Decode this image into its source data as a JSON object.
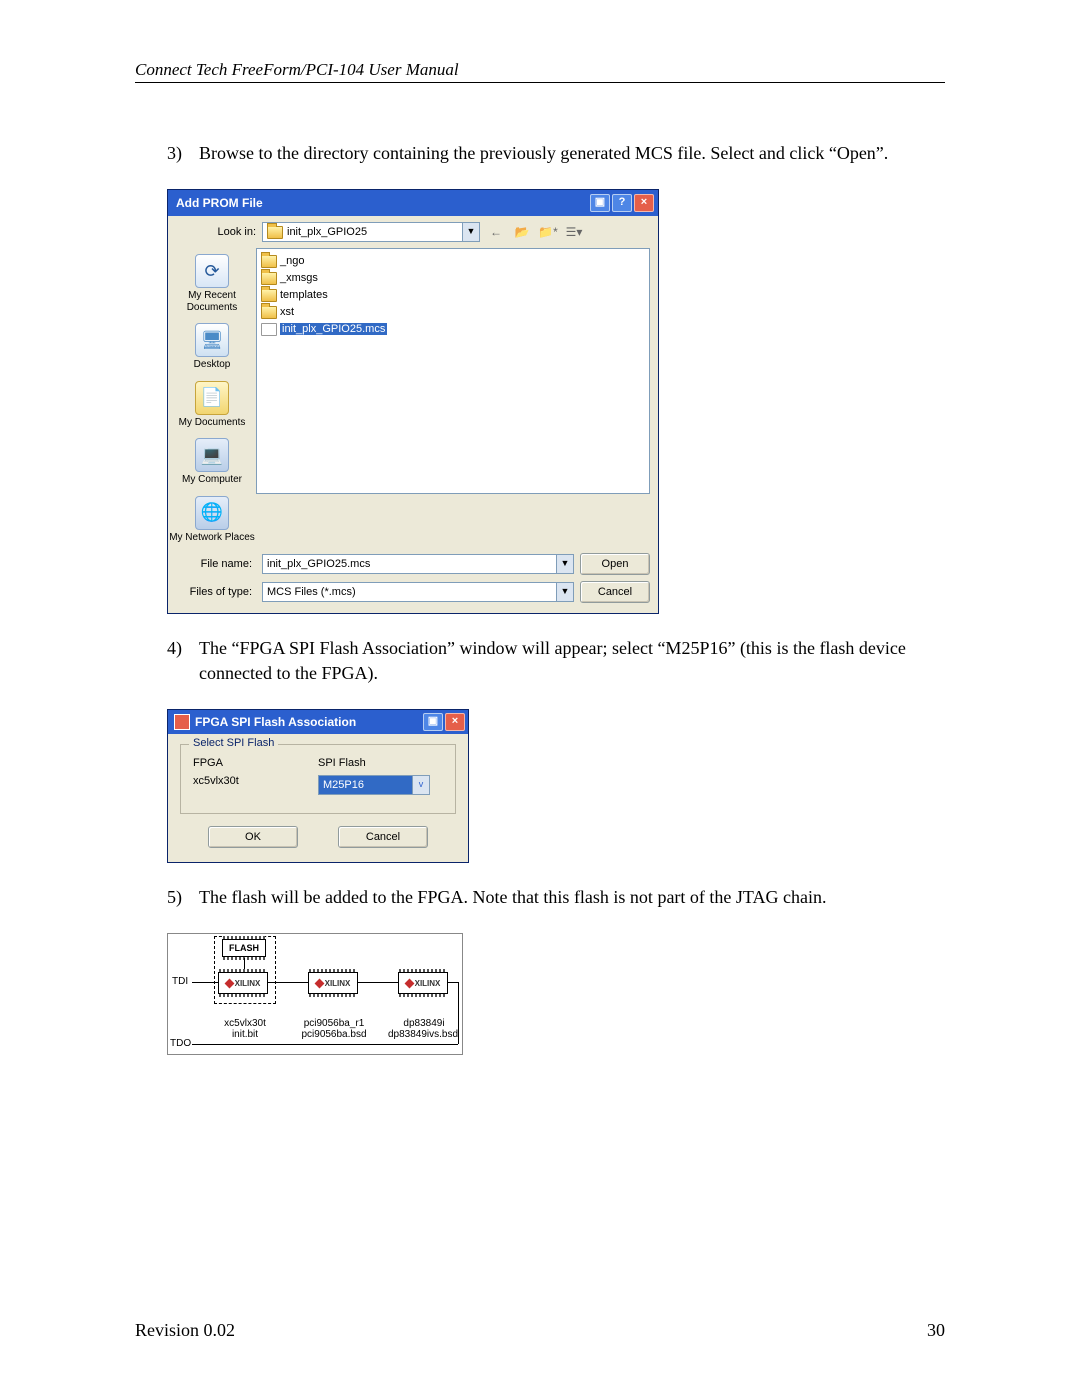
{
  "header": "Connect Tech FreeForm/PCI-104 User Manual",
  "steps": {
    "s3": {
      "num": "3)",
      "text": "Browse to the directory containing the previously generated MCS file.  Select and click “Open”."
    },
    "s4": {
      "num": "4)",
      "text": "The “FPGA SPI Flash Association” window will appear; select “M25P16” (this is the flash device connected to the FPGA)."
    },
    "s5": {
      "num": "5)",
      "text": "The flash will be added to the FPGA.  Note that this flash is not part of the JTAG chain."
    }
  },
  "dlg1": {
    "title": "Add PROM File",
    "lookin_label": "Look in:",
    "lookin_value": "init_plx_GPIO25",
    "places": {
      "recent": "My Recent Documents",
      "desktop": "Desktop",
      "mydocs": "My Documents",
      "mycomp": "My Computer",
      "mynet": "My Network Places"
    },
    "files": {
      "f0": "_ngo",
      "f1": "_xmsgs",
      "f2": "templates",
      "f3": "xst",
      "f4": "init_plx_GPIO25.mcs"
    },
    "filename_label": "File name:",
    "filename_value": "init_plx_GPIO25.mcs",
    "filetype_label": "Files of type:",
    "filetype_value": "MCS Files (*.mcs)",
    "open": "Open",
    "cancel": "Cancel"
  },
  "dlg2": {
    "title": "FPGA SPI Flash Association",
    "legend": "Select SPI Flash",
    "fpga_header": "FPGA",
    "fpga_value": "xc5vlx30t",
    "spi_header": "SPI Flash",
    "spi_value": "M25P16",
    "ok": "OK",
    "cancel": "Cancel"
  },
  "jtag": {
    "flash": "FLASH",
    "xil": "XILINX",
    "tdi": "TDI",
    "tdo": "TDO",
    "c1a": "xc5vlx30t",
    "c1b": "init.bit",
    "c2a": "pci9056ba_r1",
    "c2b": "pci9056ba.bsd",
    "c3a": "dp83849i",
    "c3b": "dp83849ivs.bsd"
  },
  "footer": {
    "left": "Revision 0.02",
    "right": "30"
  }
}
